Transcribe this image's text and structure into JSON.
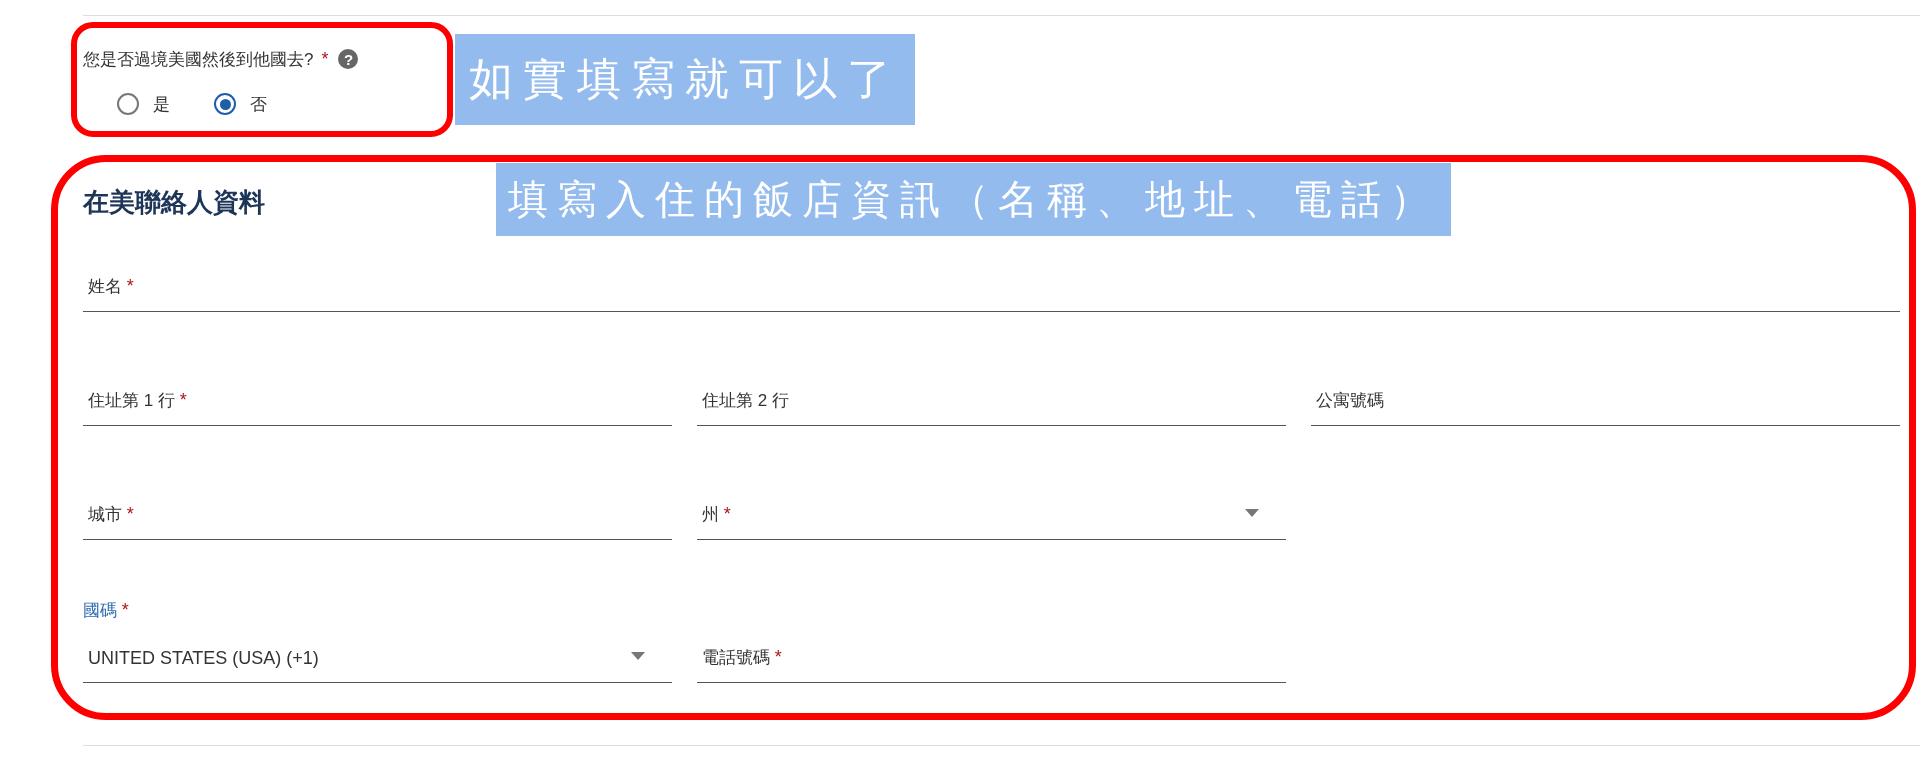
{
  "required_mark": "*",
  "question": {
    "label": "您是否過境美國然後到他國去?",
    "required": true,
    "help_icon": "?",
    "options": [
      {
        "label": "是",
        "selected": false
      },
      {
        "label": "否",
        "selected": true
      }
    ]
  },
  "section": {
    "title": "在美聯絡人資料",
    "rows": [
      [
        {
          "label": "姓名",
          "required": true,
          "kind": "text"
        }
      ],
      [
        {
          "label": "住址第 1 行",
          "required": true,
          "kind": "text"
        },
        {
          "label": "住址第 2 行",
          "required": false,
          "kind": "text"
        },
        {
          "label": "公寓號碼",
          "required": false,
          "kind": "text"
        }
      ],
      [
        {
          "label": "城市",
          "required": true,
          "kind": "text"
        },
        {
          "label": "州",
          "required": true,
          "kind": "select"
        }
      ],
      [
        {
          "label": "國碼",
          "required": true,
          "kind": "select",
          "value": "UNITED STATES (USA) (+1)"
        },
        {
          "label": "電話號碼",
          "required": true,
          "kind": "text"
        }
      ]
    ]
  },
  "notes": [
    {
      "text": "如實填寫就可以了"
    },
    {
      "text": "填寫入住的飯店資訊（名稱、地址、電話）"
    }
  ]
}
